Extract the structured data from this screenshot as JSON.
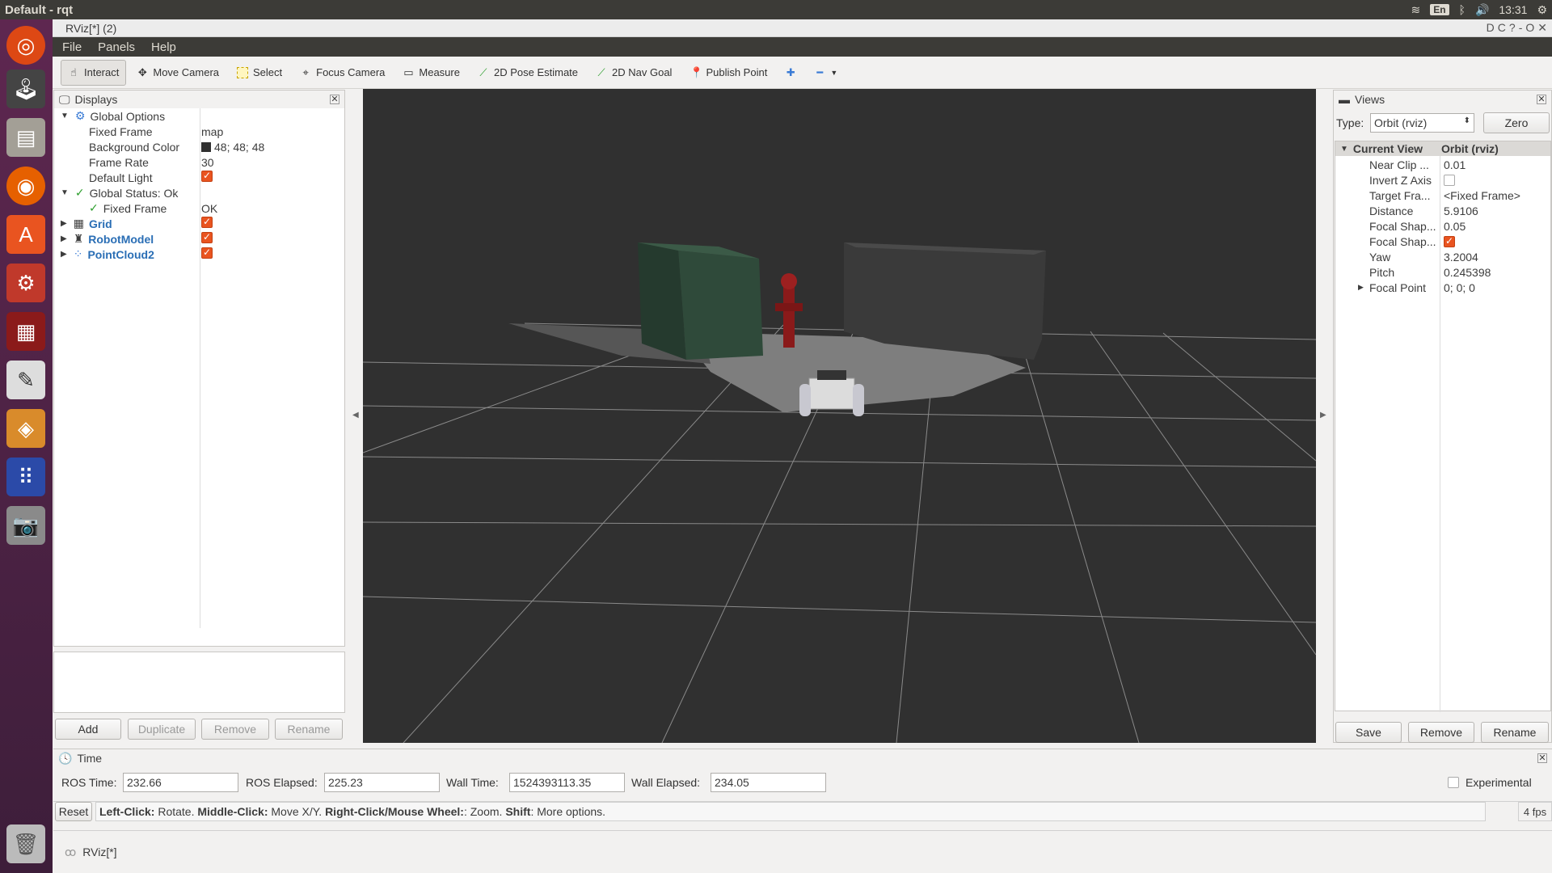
{
  "os": {
    "title": "Default - rqt",
    "lang": "En",
    "clock": "13:31"
  },
  "window": {
    "title": "RViz[*] (2)"
  },
  "menu": [
    "File",
    "Panels",
    "Help"
  ],
  "toolbar": {
    "interact": "Interact",
    "move_camera": "Move Camera",
    "select": "Select",
    "focus_camera": "Focus Camera",
    "measure": "Measure",
    "pose_estimate": "2D Pose Estimate",
    "nav_goal": "2D Nav Goal",
    "publish_point": "Publish Point"
  },
  "displays": {
    "title": "Displays",
    "global_options": "Global Options",
    "fixed_frame": {
      "label": "Fixed Frame",
      "value": "map"
    },
    "background_color": {
      "label": "Background Color",
      "value": "48; 48; 48",
      "swatch": "#303030"
    },
    "frame_rate": {
      "label": "Frame Rate",
      "value": "30"
    },
    "default_light": {
      "label": "Default Light"
    },
    "global_status": "Global Status: Ok",
    "status_fixed_frame": {
      "label": "Fixed Frame",
      "value": "OK"
    },
    "items": [
      "Grid",
      "RobotModel",
      "PointCloud2"
    ],
    "buttons": {
      "add": "Add",
      "duplicate": "Duplicate",
      "remove": "Remove",
      "rename": "Rename"
    }
  },
  "views": {
    "title": "Views",
    "type_label": "Type:",
    "type_value": "Orbit (rviz)",
    "zero": "Zero",
    "header_left": "Current View",
    "header_right": "Orbit (rviz)",
    "rows": [
      {
        "k": "Near Clip ...",
        "v": "0.01"
      },
      {
        "k": "Invert Z Axis",
        "v": ""
      },
      {
        "k": "Target Fra...",
        "v": "<Fixed Frame>"
      },
      {
        "k": "Distance",
        "v": "5.9106"
      },
      {
        "k": "Focal Shap...",
        "v": "0.05"
      },
      {
        "k": "Focal Shap...",
        "v": ""
      },
      {
        "k": "Yaw",
        "v": "3.2004"
      },
      {
        "k": "Pitch",
        "v": "0.245398"
      },
      {
        "k": "Focal Point",
        "v": "0; 0; 0"
      }
    ],
    "buttons": {
      "save": "Save",
      "remove": "Remove",
      "rename": "Rename"
    }
  },
  "time": {
    "title": "Time",
    "ros_time": {
      "label": "ROS Time:",
      "value": "232.66"
    },
    "ros_elapsed": {
      "label": "ROS Elapsed:",
      "value": "225.23"
    },
    "wall_time": {
      "label": "Wall Time:",
      "value": "1524393113.35"
    },
    "wall_elapsed": {
      "label": "Wall Elapsed:",
      "value": "234.05"
    },
    "experimental": "Experimental"
  },
  "status": {
    "reset": "Reset",
    "lc": "Left-Click:",
    "lc_t": " Rotate. ",
    "mc": "Middle-Click:",
    "mc_t": " Move X/Y. ",
    "rc": "Right-Click/Mouse Wheel:",
    "rc_t": ": Zoom. ",
    "sh": "Shift",
    "sh_t": ": More options.",
    "fps": "4 fps"
  },
  "taskbar_item": "RViz[*]"
}
